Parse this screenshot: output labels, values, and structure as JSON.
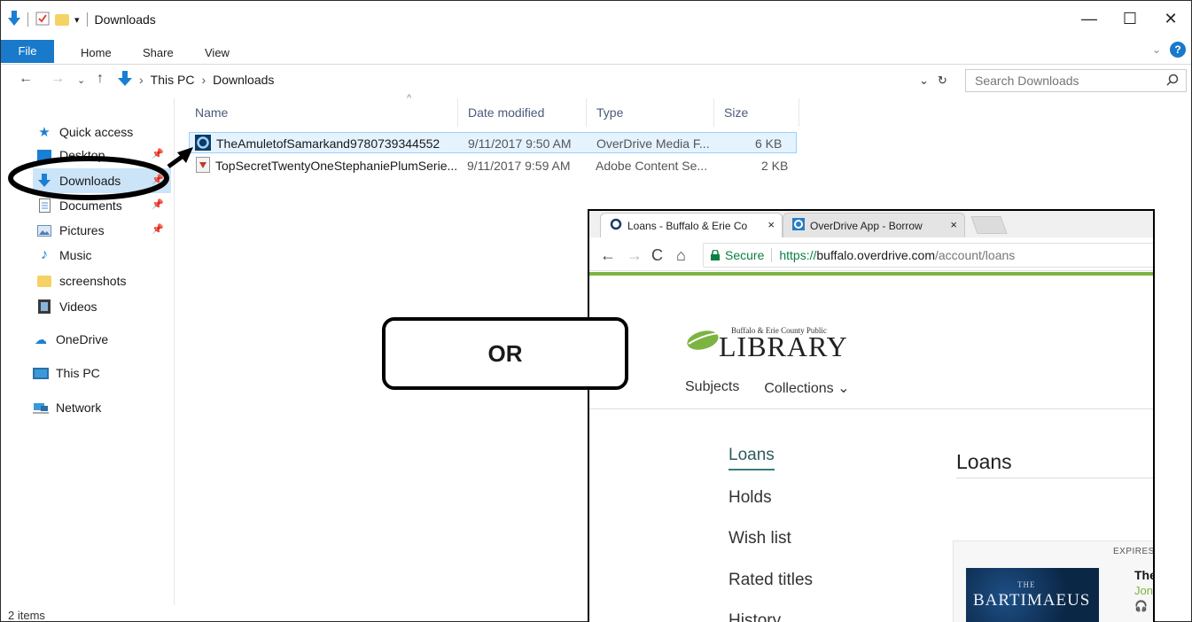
{
  "window": {
    "title": "Downloads",
    "controls": {
      "minimize": "—",
      "maximize": "☐",
      "close": "✕"
    }
  },
  "ribbon": {
    "tabs": [
      "File",
      "Home",
      "Share",
      "View"
    ],
    "expand_icon": "chevron-down-icon",
    "help_icon": "help-icon"
  },
  "address": {
    "crumbs": [
      "This PC",
      "Downloads"
    ],
    "search_placeholder": "Search Downloads"
  },
  "navpane": {
    "quick_access": "Quick access",
    "items": [
      {
        "label": "Desktop",
        "icon": "desktop-icon",
        "pinned": true
      },
      {
        "label": "Downloads",
        "icon": "downloads-icon",
        "pinned": true,
        "selected": true
      },
      {
        "label": "Documents",
        "icon": "documents-icon",
        "pinned": true
      },
      {
        "label": "Pictures",
        "icon": "pictures-icon",
        "pinned": true
      },
      {
        "label": "Music",
        "icon": "music-icon",
        "pinned": false
      },
      {
        "label": "screenshots",
        "icon": "folder-icon",
        "pinned": false
      },
      {
        "label": "Videos",
        "icon": "videos-icon",
        "pinned": false
      }
    ],
    "onedrive": "OneDrive",
    "thispc": "This PC",
    "network": "Network"
  },
  "filelist": {
    "columns": [
      "Name",
      "Date modified",
      "Type",
      "Size"
    ],
    "rows": [
      {
        "name": "TheAmuletofSamarkand9780739344552",
        "date": "9/11/2017 9:50 AM",
        "type": "OverDrive Media F...",
        "size": "6 KB",
        "icon": "overdrive-file-icon"
      },
      {
        "name": "TopSecretTwentyOneStephaniePlumSerie...",
        "date": "9/11/2017 9:59 AM",
        "type": "Adobe Content Se...",
        "size": "2 KB",
        "icon": "adobe-content-file-icon"
      }
    ]
  },
  "status": {
    "items": "2 items"
  },
  "overlay": {
    "or_label": "OR"
  },
  "browser": {
    "tabs": [
      {
        "label": "Loans - Buffalo & Erie Co",
        "close": "×"
      },
      {
        "label": "OverDrive App - Borrow",
        "close": "×"
      }
    ],
    "secure_label": "Secure",
    "url_scheme": "https://",
    "url_host": "buffalo.overdrive.com",
    "url_path": "/account/loans",
    "library": {
      "small": "Buffalo & Erie County Public",
      "big": "LIBRARY"
    },
    "sitenav": [
      "Subjects",
      "Collections"
    ],
    "sidebar": [
      "Loans",
      "Holds",
      "Wish list",
      "Rated titles",
      "History"
    ],
    "page_heading": "Loans",
    "card": {
      "expires": "EXPIRES I",
      "cover_the": "THE",
      "cover_title": "BARTIMAEUS",
      "title": "The",
      "author": "Jon"
    }
  },
  "colors": {
    "accent_blue": "#1979ca",
    "selection": "#cce4f7",
    "library_green": "#7cb342"
  }
}
